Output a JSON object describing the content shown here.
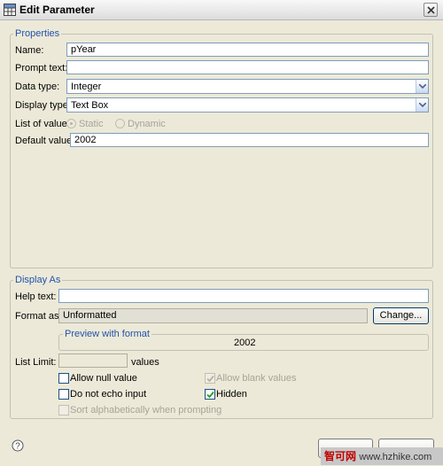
{
  "window": {
    "title": "Edit Parameter"
  },
  "properties": {
    "legend": "Properties",
    "name": {
      "label": "Name:",
      "value": "pYear"
    },
    "prompt_text": {
      "label": "Prompt text:",
      "value": ""
    },
    "data_type": {
      "label": "Data type:",
      "value": "Integer"
    },
    "display_type": {
      "label": "Display type:",
      "value": "Text Box"
    },
    "list_of_value": {
      "label": "List of value:",
      "options": [
        "Static",
        "Dynamic"
      ],
      "selected": "Static"
    },
    "default_value": {
      "label": "Default value:",
      "value": "2002"
    }
  },
  "display_as": {
    "legend": "Display As",
    "help_text": {
      "label": "Help text:",
      "value": ""
    },
    "format_as": {
      "label": "Format as:",
      "value": "Unformatted",
      "button": "Change..."
    },
    "preview": {
      "legend": "Preview with format",
      "value": "2002"
    },
    "list_limit": {
      "label": "List Limit:",
      "value": "",
      "suffix": "values"
    },
    "options": {
      "allow_null": {
        "label": "Allow null value",
        "checked": false,
        "enabled": true
      },
      "allow_blank": {
        "label": "Allow blank values",
        "checked": true,
        "enabled": false
      },
      "no_echo": {
        "label": "Do not echo input",
        "checked": false,
        "enabled": true
      },
      "hidden": {
        "label": "Hidden",
        "checked": true,
        "enabled": true
      },
      "sort_alpha": {
        "label": "Sort alphabetically when prompting",
        "checked": false,
        "enabled": false
      }
    }
  },
  "watermark": {
    "text": "智可网",
    "url": "www.hzhike.com"
  },
  "colors": {
    "legend": "#2152ad",
    "background": "#ece9d8",
    "watermark_text": "#c00000"
  },
  "icons": {
    "app": "parameter-grid-icon",
    "close": "close-icon",
    "help": "help-icon",
    "combo": "chevron-down-icon",
    "check": "checkmark-icon"
  }
}
